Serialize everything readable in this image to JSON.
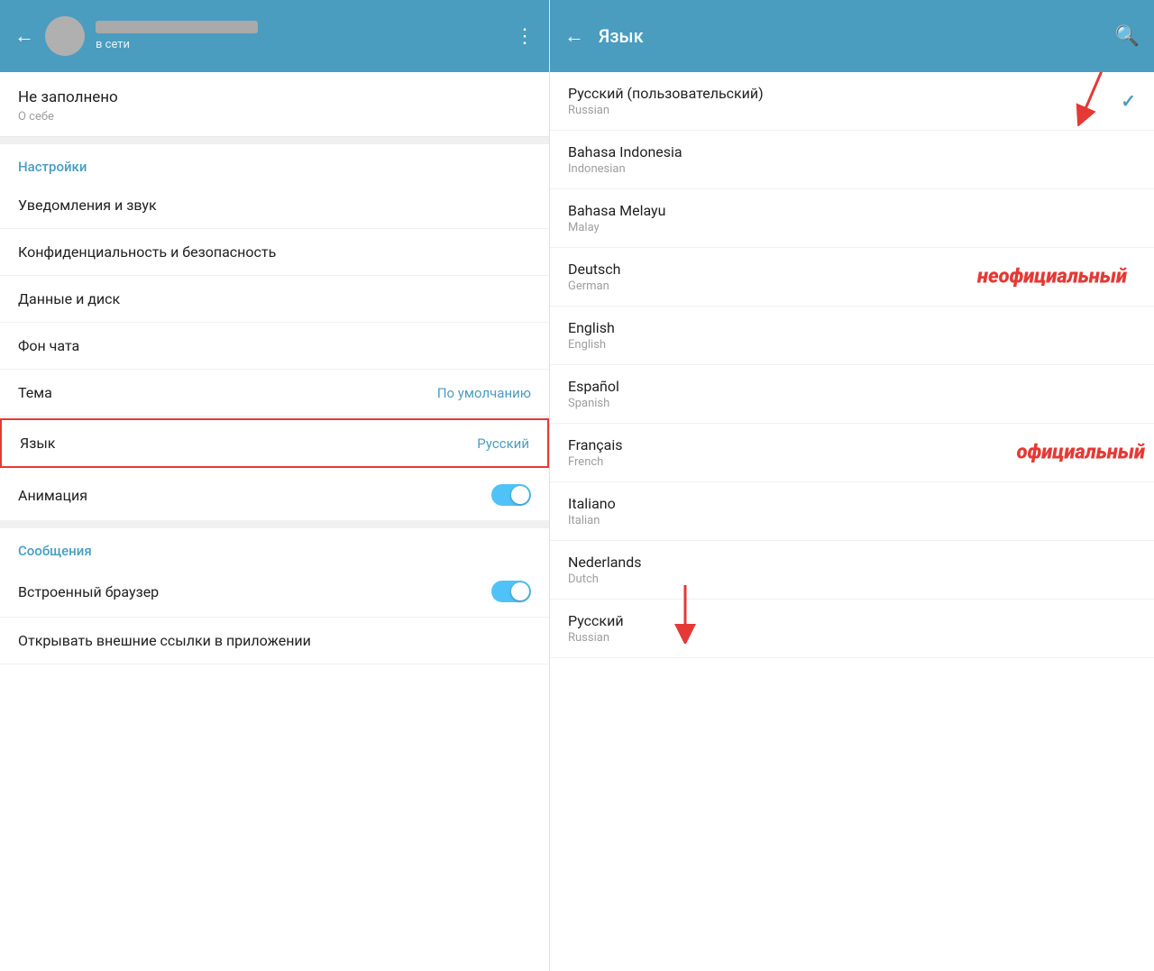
{
  "left": {
    "header": {
      "back_label": "←",
      "status": "в сети",
      "dots": "⋮"
    },
    "profile": {
      "title": "Не заполнено",
      "subtitle": "О себе"
    },
    "settings_header": "Настройки",
    "items": [
      {
        "label": "Уведомления и звук",
        "value": "",
        "type": "text"
      },
      {
        "label": "Конфиденциальность и безопасность",
        "value": "",
        "type": "text"
      },
      {
        "label": "Данные и диск",
        "value": "",
        "type": "text"
      },
      {
        "label": "Фон чата",
        "value": "",
        "type": "text"
      },
      {
        "label": "Тема",
        "value": "По умолчанию",
        "type": "value"
      },
      {
        "label": "Язык",
        "value": "Русский",
        "type": "value",
        "highlighted": true
      },
      {
        "label": "Анимация",
        "value": "",
        "type": "toggle"
      }
    ],
    "messages_header": "Сообщения",
    "messages_items": [
      {
        "label": "Встроенный браузер",
        "type": "toggle"
      },
      {
        "label": "Открывать внешние ссылки в приложении",
        "type": "toggle_partial"
      }
    ]
  },
  "right": {
    "header": {
      "back_label": "←",
      "title": "Язык",
      "search_icon": "🔍"
    },
    "languages": [
      {
        "name": "Русский (пользовательский)",
        "native": "Russian",
        "selected": true,
        "annotation": ""
      },
      {
        "name": "Bahasa Indonesia",
        "native": "Indonesian",
        "selected": false,
        "annotation": ""
      },
      {
        "name": "Bahasa Melayu",
        "native": "Malay",
        "selected": false,
        "annotation": ""
      },
      {
        "name": "Deutsch",
        "native": "German",
        "selected": false,
        "annotation": "неофициальный"
      },
      {
        "name": "English",
        "native": "English",
        "selected": false,
        "annotation": ""
      },
      {
        "name": "Español",
        "native": "Spanish",
        "selected": false,
        "annotation": ""
      },
      {
        "name": "Français",
        "native": "French",
        "selected": false,
        "annotation": "официальный"
      },
      {
        "name": "Italiano",
        "native": "Italian",
        "selected": false,
        "annotation": ""
      },
      {
        "name": "Nederlands",
        "native": "Dutch",
        "selected": false,
        "annotation": ""
      },
      {
        "name": "Русский",
        "native": "Russian",
        "selected": false,
        "annotation": ""
      }
    ],
    "annotations": {
      "unofficial": "неофициальный",
      "official": "официальный"
    }
  }
}
